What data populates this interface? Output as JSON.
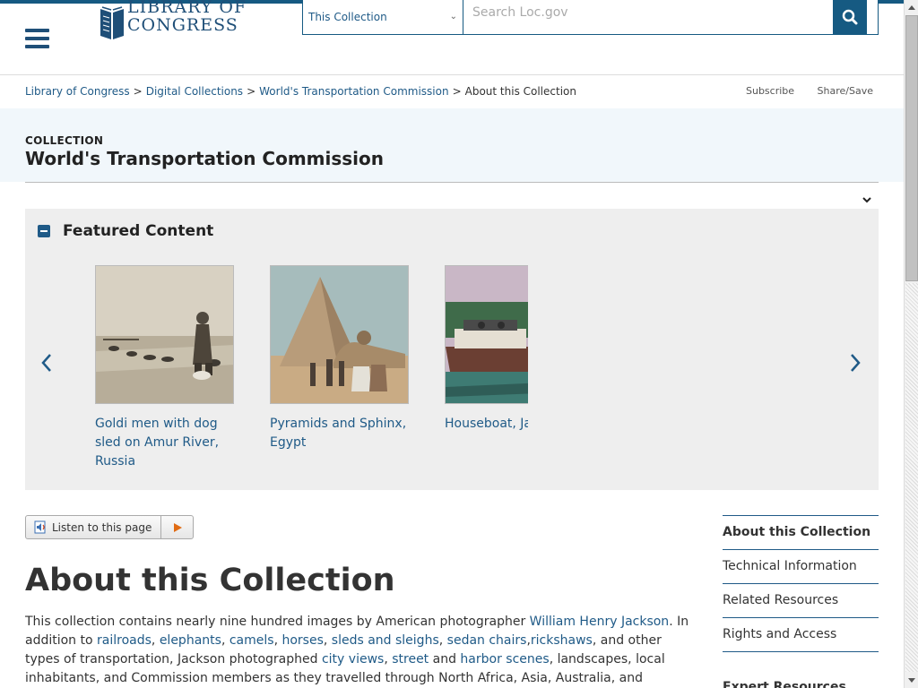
{
  "header": {
    "logo_line1": "LIBRARY OF",
    "logo_line2": "CONGRESS",
    "search_scope": "This Collection",
    "search_placeholder": "Search Loc.gov"
  },
  "breadcrumb": {
    "items": [
      "Library of Congress",
      "Digital Collections",
      "World's Transportation Commission"
    ],
    "current": "About this Collection",
    "separator": ">"
  },
  "utility": {
    "subscribe": "Subscribe",
    "share": "Share/Save"
  },
  "collection": {
    "kicker": "COLLECTION",
    "title": "World's Transportation Commission"
  },
  "featured": {
    "title": "Featured Content",
    "items": [
      {
        "caption": "Goldi men with dog sled on Amur River, Russia",
        "image": "dog-sled-photo"
      },
      {
        "caption": "Pyramids and Sphinx, Egypt",
        "image": "pyramids-photo"
      },
      {
        "caption": "Houseboat, Ja",
        "image": "houseboat-photo"
      }
    ]
  },
  "listen": {
    "label": "Listen to this page"
  },
  "main": {
    "heading": "About this Collection",
    "p1": {
      "t1": "This collection contains nearly nine hundred images by American photographer ",
      "l1": "William Henry Jackson",
      "t2": ". In addition to ",
      "l2": "railroads",
      "t3": ", ",
      "l3": "elephants",
      "t4": ", ",
      "l4": "camels",
      "t5": ", ",
      "l5": "horses",
      "t6": ", ",
      "l6": "sleds and sleighs",
      "t7": ", ",
      "l7": "sedan chairs",
      "t8": ",",
      "l8": "rickshaws",
      "t9": ", and other types of transportation, Jackson photographed ",
      "l9": "city views",
      "t10": ", ",
      "l10": "street",
      "t11": " and ",
      "l11": "harbor scenes",
      "t12": ", landscapes, local inhabitants, and Commission members as they travelled through North Africa, Asia, Australia, and"
    }
  },
  "sidebar": {
    "items": [
      "About this Collection",
      "Technical Information",
      "Related Resources",
      "Rights and Access"
    ],
    "next_heading": "Expert Resources"
  },
  "colors": {
    "brand": "#165a82",
    "link": "#1f5a87",
    "banner_bg": "#f1f7fb",
    "featured_bg": "#eeeeee"
  }
}
